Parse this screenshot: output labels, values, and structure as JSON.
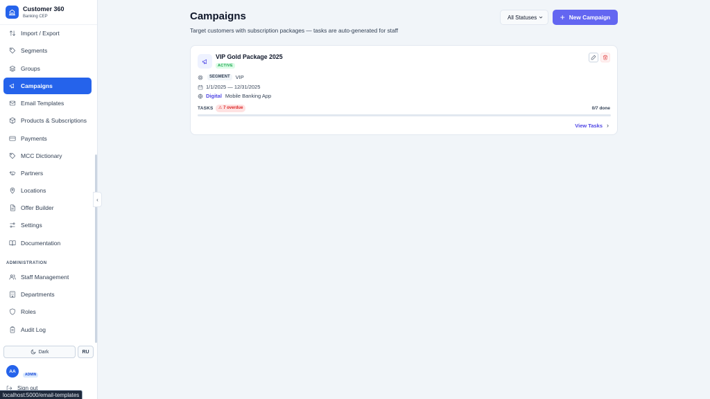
{
  "app": {
    "title": "Customer 360",
    "subtitle": "Banking CEP"
  },
  "sidebar": {
    "items": [
      {
        "label": "Import / Export",
        "icon": "arrows-up-down-icon"
      },
      {
        "label": "Segments",
        "icon": "tag-icon"
      },
      {
        "label": "Groups",
        "icon": "layers-icon"
      },
      {
        "label": "Campaigns",
        "icon": "megaphone-icon",
        "active": true
      },
      {
        "label": "Email Templates",
        "icon": "mail-icon"
      },
      {
        "label": "Products & Subscriptions",
        "icon": "package-icon"
      },
      {
        "label": "Payments",
        "icon": "credit-card-icon"
      },
      {
        "label": "MCC Dictionary",
        "icon": "tag-icon"
      },
      {
        "label": "Partners",
        "icon": "handshake-icon"
      },
      {
        "label": "Locations",
        "icon": "map-pin-icon"
      },
      {
        "label": "Offer Builder",
        "icon": "file-text-icon"
      },
      {
        "label": "Settings",
        "icon": "sliders-icon"
      },
      {
        "label": "Documentation",
        "icon": "book-open-icon"
      }
    ],
    "admin_section_title": "ADMINISTRATION",
    "admin_items": [
      {
        "label": "Staff Management",
        "icon": "users-icon"
      },
      {
        "label": "Departments",
        "icon": "building-icon"
      },
      {
        "label": "Roles",
        "icon": "shield-icon"
      },
      {
        "label": "Audit Log",
        "icon": "clipboard-icon"
      }
    ],
    "theme_label": "Dark",
    "lang_label": "RU",
    "user_initials": "AA",
    "user_role": "ADMIN",
    "signout_label": "Sign out"
  },
  "status_bar": {
    "url": "localhost:5000/email-templates"
  },
  "main": {
    "title": "Campaigns",
    "subtitle": "Target customers with subscription packages — tasks are auto-generated for staff",
    "status_filter": "All Statuses",
    "new_button_label": "New Campaign",
    "campaign": {
      "name": "VIP Gold Package 2025",
      "status": "ACTIVE",
      "segment_label": "SEGMENT",
      "segment_value": "VIP",
      "date_range": "1/1/2025 — 12/31/2025",
      "channel": "Digital",
      "channel_detail": "Mobile Banking App",
      "tasks_label": "TASKS",
      "overdue": "7 overdue",
      "done": "0/7 done",
      "progress": 0,
      "view_label": "View Tasks"
    }
  },
  "colors": {
    "primary": "#2563eb",
    "accent": "#6366f1",
    "success": "#16a34a",
    "danger": "#dc2626"
  }
}
